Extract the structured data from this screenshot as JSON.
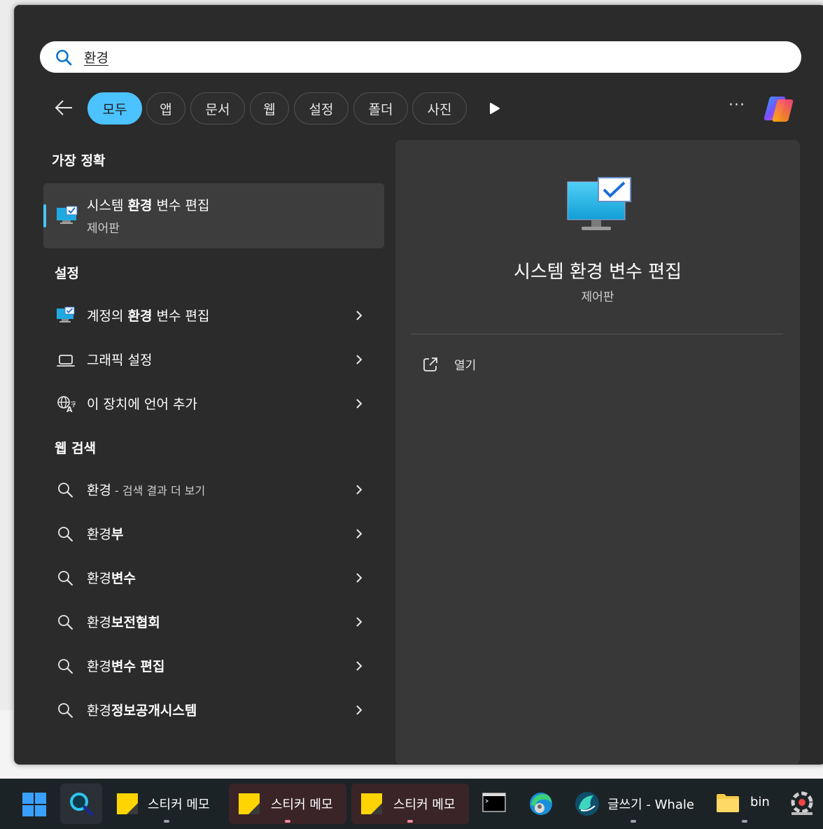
{
  "search": {
    "query": "환경"
  },
  "tabs": [
    {
      "label": "모두",
      "active": true
    },
    {
      "label": "앱"
    },
    {
      "label": "문서"
    },
    {
      "label": "웹"
    },
    {
      "label": "설정"
    },
    {
      "label": "폴더"
    },
    {
      "label": "사진"
    }
  ],
  "more_options": "···",
  "best_match": {
    "heading": "가장 정확",
    "title_pre": "시스템 ",
    "title_bold": "환경",
    "title_post": " 변수 편집",
    "subtitle": "제어판"
  },
  "settings": {
    "heading": "설정",
    "items": [
      {
        "pre": "계정의 ",
        "bold": "환경",
        "post": " 변수 편집",
        "icon": "monitor-check-icon"
      },
      {
        "pre": "그래픽 설정",
        "bold": "",
        "post": "",
        "icon": "laptop-icon"
      },
      {
        "pre": "이 장치에 언어 추가",
        "bold": "",
        "post": "",
        "icon": "language-icon"
      }
    ]
  },
  "web": {
    "heading": "웹 검색",
    "first": {
      "text": "환경",
      "sub": " - 검색 결과 더 보기"
    },
    "items": [
      {
        "pre": "환경",
        "bold": "부"
      },
      {
        "pre": "환경",
        "bold": "변수"
      },
      {
        "pre": "환경",
        "bold": "보전협회"
      },
      {
        "pre": "환경",
        "bold": "변수 편집"
      },
      {
        "pre": "환경",
        "bold": "정보공개시스템"
      }
    ]
  },
  "detail": {
    "title": "시스템 환경 변수 편집",
    "subtitle": "제어판",
    "open_label": "열기"
  },
  "taskbar": {
    "sticky1": "스티커 메모",
    "sticky2": "스티커 메모",
    "sticky3": "스티커 메모",
    "whale": "글쓰기 - Whale",
    "folder": "bin"
  },
  "colors": {
    "accent": "#4cc2ff",
    "panel": "#2b2b2b",
    "detail": "#383838"
  }
}
